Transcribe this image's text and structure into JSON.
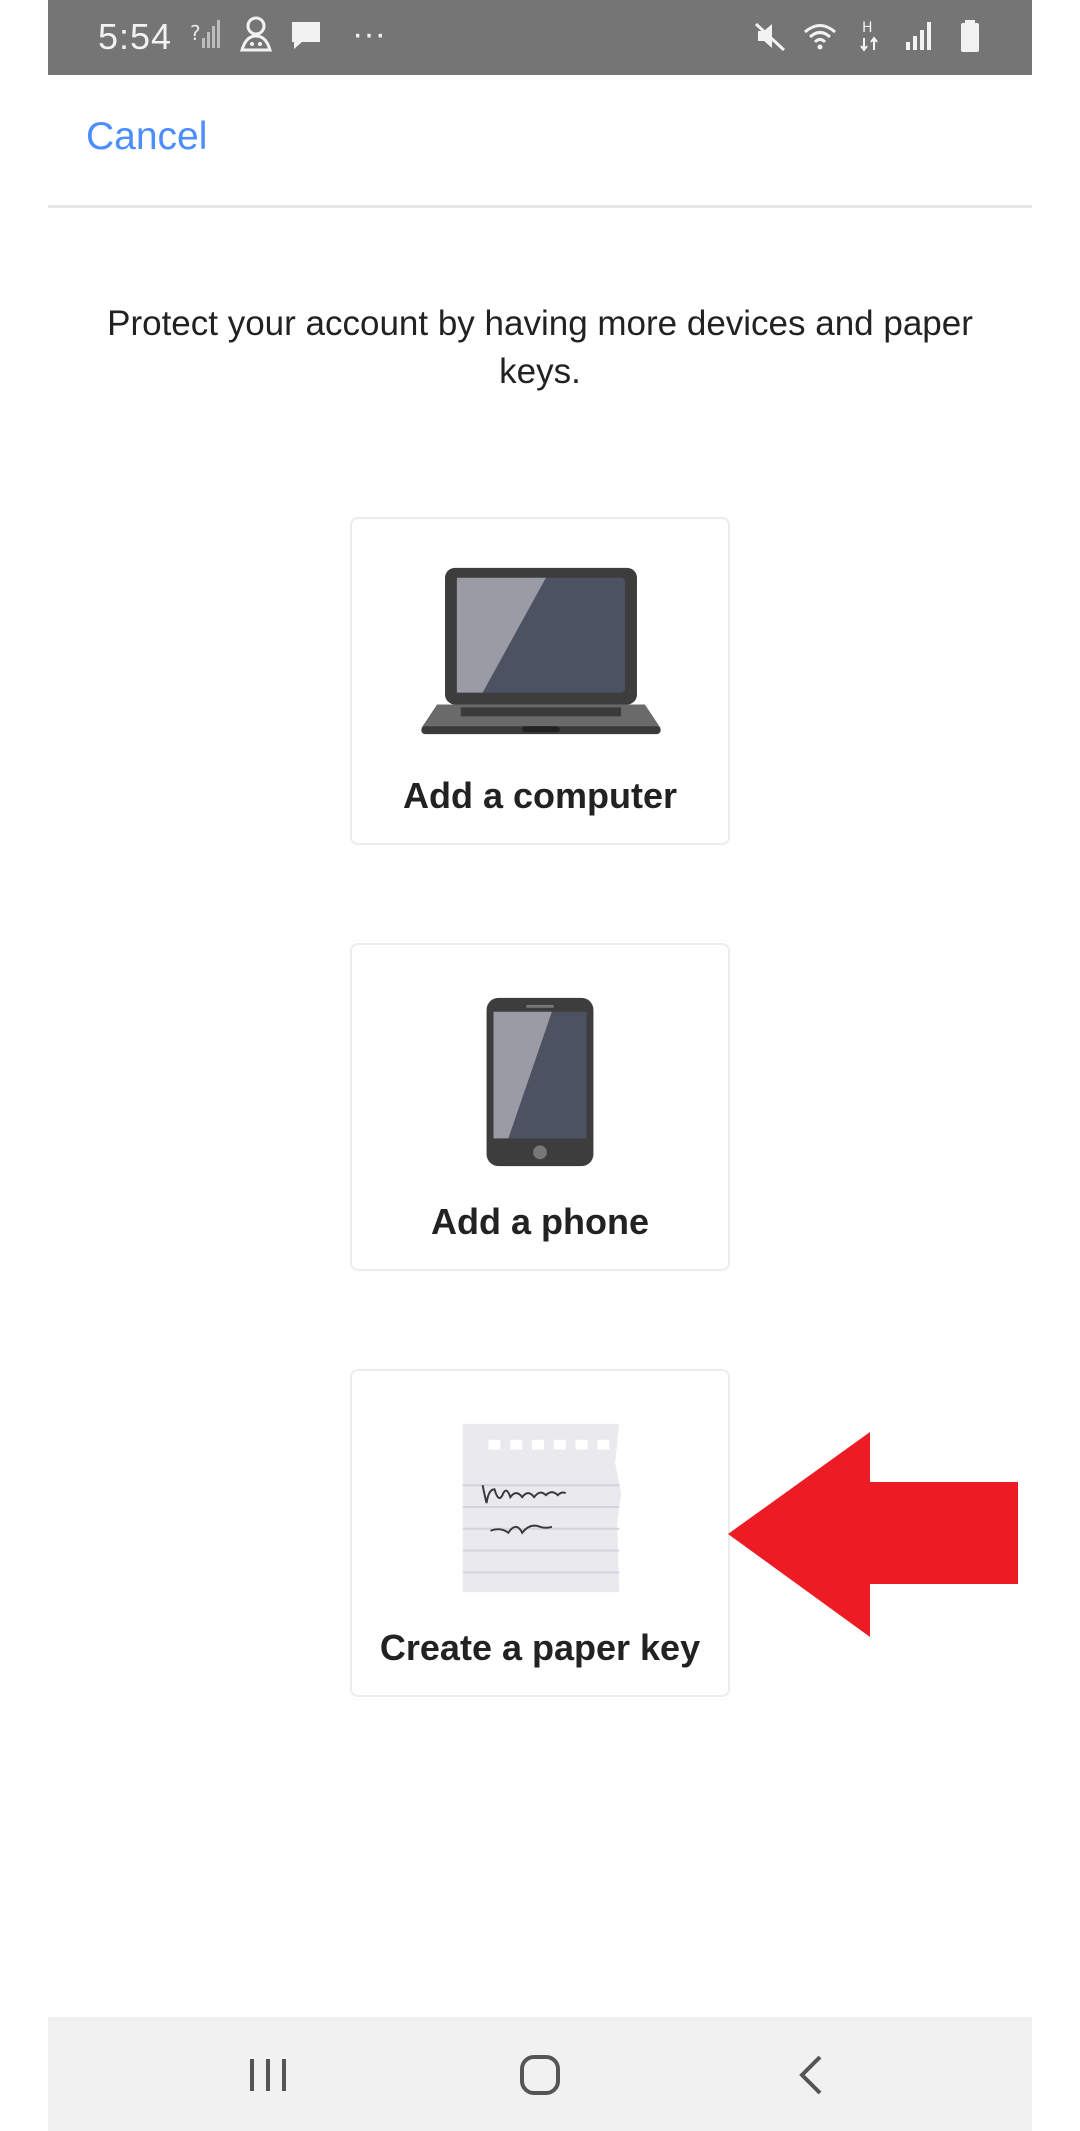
{
  "status_bar": {
    "time": "5:54",
    "left_icons": [
      "no-sim-signal-icon",
      "app-notification-icon",
      "message-icon"
    ],
    "more": "···",
    "right_icons": [
      "mute-icon",
      "wifi-icon",
      "h-data-icon",
      "signal-icon",
      "battery-icon"
    ]
  },
  "header": {
    "cancel_label": "Cancel"
  },
  "intro_text": "Protect your account by having more devices and paper keys.",
  "options": [
    {
      "label": "Add a computer",
      "icon": "laptop-icon"
    },
    {
      "label": "Add a phone",
      "icon": "phone-icon"
    },
    {
      "label": "Create a paper key",
      "icon": "paper-key-icon"
    }
  ],
  "annotation": {
    "arrow_color": "#ed1c24"
  },
  "colors": {
    "accent": "#4c8eff",
    "status_bar": "#757575",
    "nav_bar": "#f1f1f1"
  },
  "nav_bar": {
    "buttons": [
      "recent-apps-icon",
      "home-icon",
      "back-icon"
    ]
  }
}
